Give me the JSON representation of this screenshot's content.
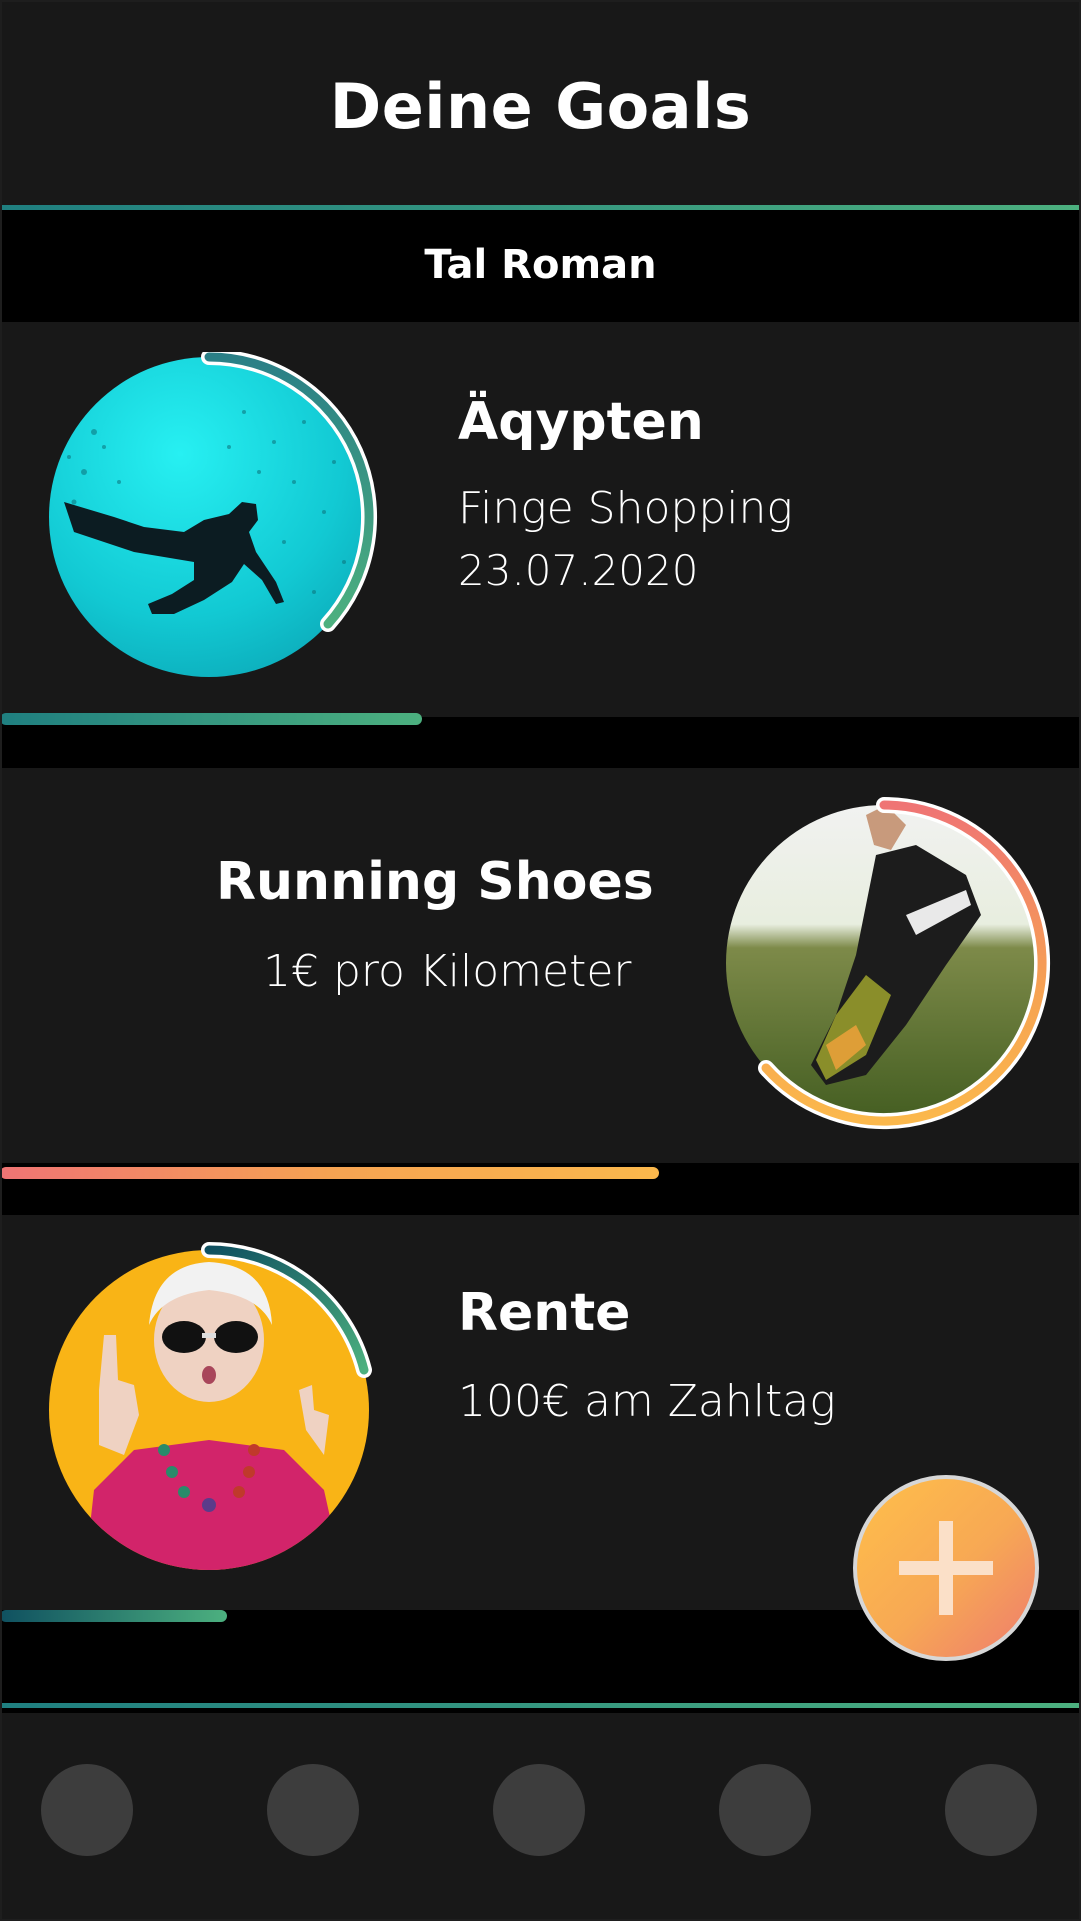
{
  "header": {
    "title": "Deine Goals"
  },
  "user": {
    "name": "Tal Roman"
  },
  "goals": [
    {
      "title": "Äqypten",
      "lines": [
        "Finge Shopping",
        "23.07.2020"
      ],
      "image": "scuba-diver-underwater-photo",
      "progress": 0.39,
      "colors": [
        "#1f7f80",
        "#4cb07f"
      ]
    },
    {
      "title": "Running Shoes",
      "lines": [
        "1€ pro Kilometer"
      ],
      "image": "running-shoes-in-field-photo",
      "progress": 0.61,
      "colors": [
        "#ef7474",
        "#f6a352",
        "#fbb84c"
      ]
    },
    {
      "title": "Rente",
      "lines": [
        "100€ am Zahltag"
      ],
      "image": "senior-woman-sunglasses-photo",
      "progress": 0.21,
      "colors": [
        "#0f5060",
        "#4cb07f"
      ]
    }
  ],
  "fab": {
    "icon": "plus-icon"
  },
  "nav": {
    "items": [
      "nav-item-1",
      "nav-item-2",
      "nav-item-3",
      "nav-item-4",
      "nav-item-5"
    ]
  }
}
